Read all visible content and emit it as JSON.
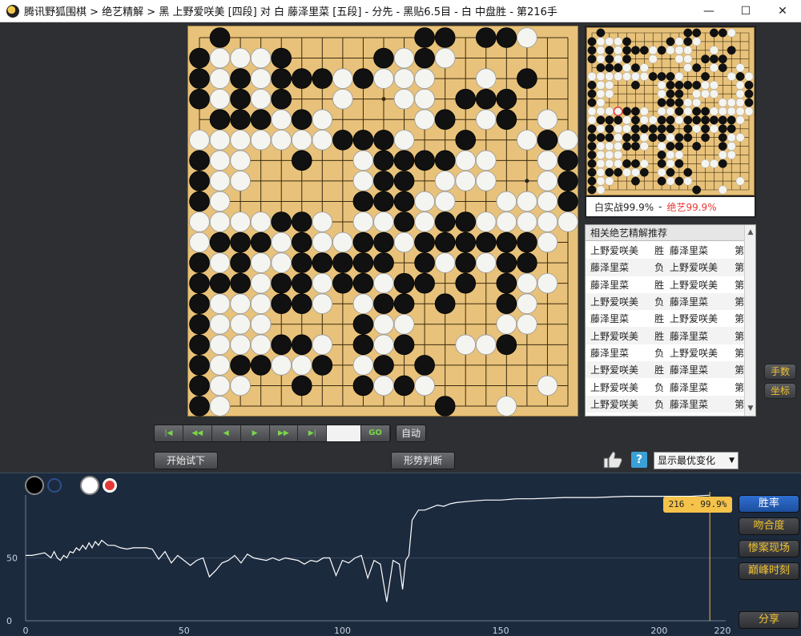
{
  "window": {
    "title": "腾讯野狐围棋 > 绝艺精解 > 黑 上野爱咲美 [四段] 对 白 藤泽里菜 [五段] - 分先 - 黑贴6.5目 - 白 中盘胜 - 第216手",
    "minimize": "—",
    "maximize": "☐",
    "close": "✕"
  },
  "board": {
    "size": 19,
    "rows": [
      ".B.........BB.BBW...",
      "BWWWB....BWBW......",
      "BWBWBBBWBWWW..W.B..",
      "BWBWB..W..WW.BBB..",
      ".BBBWBW....WB.WB.W",
      "WWWWWWWBBBW..B..WBW",
      "BWW..B..WBBBBWW..WB",
      "BWW.....WBB.WWW..WBB",
      "BW......BBBWW..WWWB",
      "WWWWBBW.WWBWBBWWWWW",
      "WBBBWBWWBBWBBBBBBW",
      "BWBWWBBBBB.BWBWBB.",
      "BBBWBBWBBWBB.B.BWW",
      "BWWWBBW.WBB.B..BW.",
      "BWWW....BWW....WW",
      "BWWWBBW.BWB..WWB..",
      "BWBBWWB.WB.B.......",
      "BWW..B..BWBW.....W.",
      "BW..........B..W..."
    ],
    "last_move": "11,9",
    "marks": [
      [
        7,
        16
      ],
      [
        5,
        17
      ],
      [
        7,
        14
      ]
    ]
  },
  "mini_board": {
    "last_move": "9,3"
  },
  "winrate": {
    "real_label": "白实战99.9%",
    "dash": "-",
    "ai_label": "绝艺99.9%"
  },
  "recommend": {
    "header": "相关绝艺精解推荐",
    "rows": [
      {
        "a": "上野爱咲美",
        "r": "胜",
        "b": "藤泽里菜",
        "n": "第"
      },
      {
        "a": "藤泽里菜",
        "r": "负",
        "b": "上野爱咲美",
        "n": "第"
      },
      {
        "a": "藤泽里菜",
        "r": "胜",
        "b": "上野爱咲美",
        "n": "第"
      },
      {
        "a": "上野爱咲美",
        "r": "负",
        "b": "藤泽里菜",
        "n": "第"
      },
      {
        "a": "藤泽里菜",
        "r": "胜",
        "b": "上野爱咲美",
        "n": "第"
      },
      {
        "a": "上野爱咲美",
        "r": "胜",
        "b": "藤泽里菜",
        "n": "第"
      },
      {
        "a": "藤泽里菜",
        "r": "负",
        "b": "上野爱咲美",
        "n": "第"
      },
      {
        "a": "上野爱咲美",
        "r": "胜",
        "b": "藤泽里菜",
        "n": "第"
      },
      {
        "a": "上野爱咲美",
        "r": "负",
        "b": "藤泽里菜",
        "n": "第"
      },
      {
        "a": "上野爱咲美",
        "r": "负",
        "b": "藤泽里菜",
        "n": "第"
      },
      {
        "a": "藤泽里菜",
        "r": "胜",
        "b": "上野爱咲美",
        "n": "第"
      }
    ]
  },
  "side_buttons": {
    "moves": "手数",
    "coords": "坐标"
  },
  "nav": {
    "first": "|◀",
    "prev10": "◀◀",
    "prev": "◀",
    "next": "▶",
    "next10": "▶▶",
    "last": "▶|",
    "go": "GO",
    "auto": "自动"
  },
  "actions": {
    "try_play": "开始试下",
    "judge": "形势判断",
    "variation": "显示最优变化"
  },
  "graph": {
    "y_labels": [
      "50",
      "0"
    ],
    "x_labels": [
      "0",
      "50",
      "100",
      "150",
      "200",
      "220"
    ],
    "tooltip": "216 - 99.9%",
    "buttons": {
      "winrate": "胜率",
      "match": "吻合度",
      "blunder": "惨案现场",
      "peak": "巅峰时刻",
      "share": "分享"
    },
    "legend_colors": [
      "#000000",
      "#ffffff",
      "#e53935"
    ]
  },
  "chart_data": {
    "type": "line",
    "title": "",
    "xlabel": "",
    "ylabel": "",
    "xlim": [
      0,
      220
    ],
    "ylim": [
      0,
      100
    ],
    "series": [
      {
        "x": [
          0,
          2,
          4,
          6,
          8,
          9,
          10,
          11,
          12,
          13,
          14,
          15,
          16,
          17,
          18,
          19,
          20,
          21,
          22,
          23,
          24,
          25,
          26,
          28,
          30,
          32,
          34,
          36,
          38,
          40,
          42,
          44,
          46,
          48,
          50,
          52,
          54,
          56,
          58,
          60,
          62,
          64,
          66,
          68,
          70,
          72,
          74,
          76,
          78,
          80,
          82,
          84,
          86,
          88,
          90,
          92,
          94,
          96,
          98,
          100,
          102,
          104,
          106,
          108,
          110,
          112,
          114,
          116,
          118,
          119,
          120,
          121,
          122,
          123,
          124,
          126,
          128,
          130,
          132,
          134,
          136,
          140,
          145,
          150,
          155,
          160,
          170,
          180,
          190,
          200,
          210,
          216
        ],
        "y": [
          52,
          52,
          53,
          54,
          50,
          55,
          50,
          48,
          52,
          50,
          55,
          54,
          58,
          56,
          60,
          57,
          62,
          58,
          63,
          60,
          64,
          62,
          60,
          60,
          58,
          57,
          58,
          58,
          58,
          57,
          49,
          55,
          46,
          52,
          48,
          44,
          48,
          50,
          35,
          40,
          46,
          48,
          52,
          46,
          53,
          50,
          49,
          48,
          50,
          48,
          50,
          49,
          48,
          45,
          48,
          47,
          50,
          50,
          36,
          48,
          46,
          50,
          52,
          34,
          48,
          45,
          15,
          48,
          45,
          25,
          48,
          52,
          80,
          84,
          88,
          88,
          90,
          92,
          91,
          93,
          94,
          95,
          96,
          96,
          97,
          97,
          98,
          98,
          99,
          99,
          99,
          99.9
        ]
      }
    ]
  }
}
